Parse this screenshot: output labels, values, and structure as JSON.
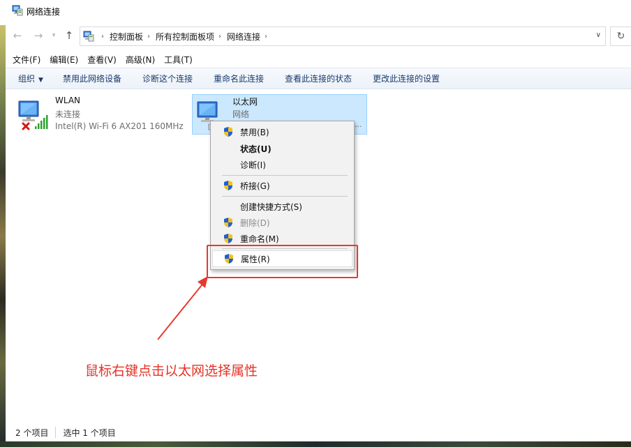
{
  "window": {
    "title": "网络连接"
  },
  "address": {
    "crumbs": [
      "控制面板",
      "所有控制面板项",
      "网络连接"
    ]
  },
  "menubar": [
    "文件(F)",
    "编辑(E)",
    "查看(V)",
    "高级(N)",
    "工具(T)"
  ],
  "commandbar": {
    "organize": "组织",
    "commands": [
      "禁用此网络设备",
      "诊断这个连接",
      "重命名此连接",
      "查看此连接的状态",
      "更改此连接的设置"
    ]
  },
  "connections": {
    "wlan": {
      "name": "WLAN",
      "status": "未连接",
      "device": "Intel(R) Wi-Fi 6 AX201 160MHz"
    },
    "ethernet": {
      "name": "以太网",
      "status": "网络",
      "device": "..."
    }
  },
  "context_menu": {
    "disable": "禁用(B)",
    "status": "状态(U)",
    "diagnose": "诊断(I)",
    "bridge": "桥接(G)",
    "shortcut": "创建快捷方式(S)",
    "delete": "删除(D)",
    "rename": "重命名(M)",
    "properties": "属性(R)"
  },
  "annotation": {
    "text": "鼠标右键点击以太网选择属性",
    "color": "#e53225"
  },
  "statusbar": {
    "item_count": "2 个项目",
    "selected_count": "选中 1 个项目"
  },
  "colors": {
    "selection_bg": "#cce8ff",
    "selection_border": "#99d1ff",
    "command_text": "#1a3a6a",
    "annotation": "#e8382d"
  }
}
